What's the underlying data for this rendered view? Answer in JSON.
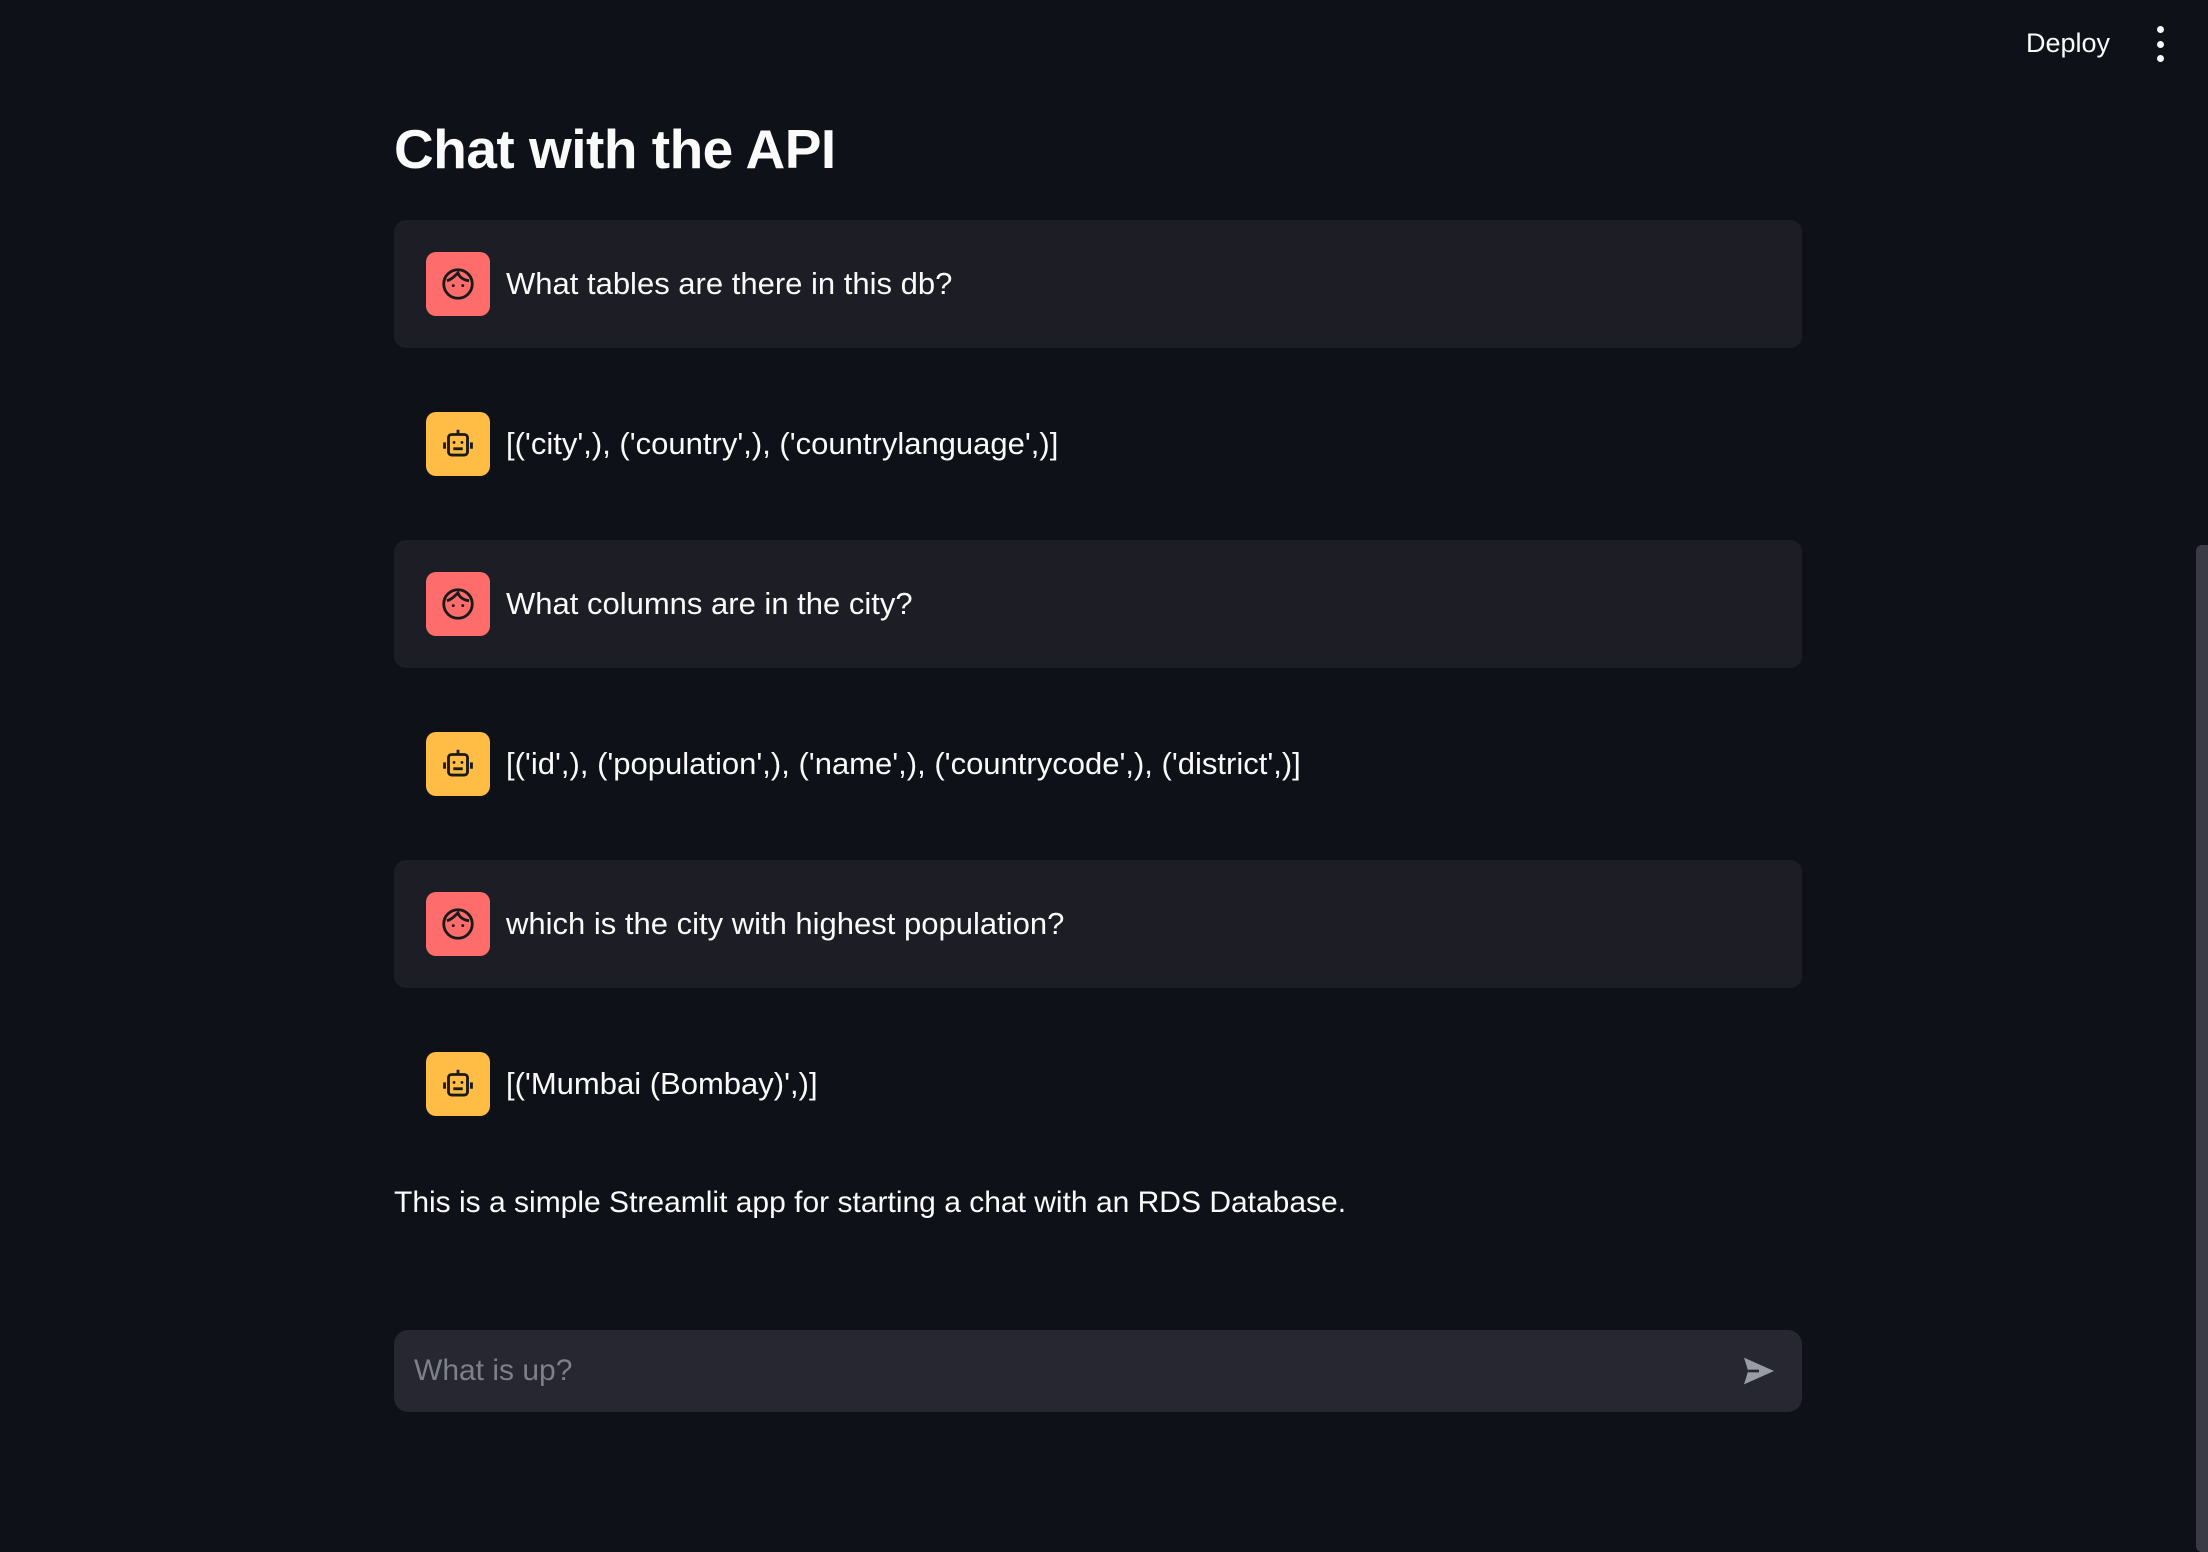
{
  "header": {
    "deploy_label": "Deploy",
    "menu_icon": "vertical-ellipsis-icon"
  },
  "main": {
    "title": "Chat with the API",
    "messages": [
      {
        "role": "user",
        "icon": "user-face-icon",
        "text": "What tables are there in this db?"
      },
      {
        "role": "assistant",
        "icon": "robot-icon",
        "text": "[('city',), ('country',), ('countrylanguage',)]"
      },
      {
        "role": "user",
        "icon": "user-face-icon",
        "text": "What columns are in the city?"
      },
      {
        "role": "assistant",
        "icon": "robot-icon",
        "text": "[('id',), ('population',), ('name',), ('countrycode',), ('district',)]"
      },
      {
        "role": "user",
        "icon": "user-face-icon",
        "text": "which is the city with highest population?"
      },
      {
        "role": "assistant",
        "icon": "robot-icon",
        "text": "[('Mumbai (Bombay)',)]"
      }
    ],
    "caption": "This is a simple Streamlit app for starting a chat with an RDS Database."
  },
  "chat_input": {
    "placeholder": "What is up?",
    "value": "",
    "send_icon": "send-icon"
  },
  "colors": {
    "background": "#0e1117",
    "user_avatar": "#ff6c6c",
    "assistant_avatar": "#ffbd45",
    "user_message_bg": "#1c1d25",
    "input_bg": "#262730"
  }
}
